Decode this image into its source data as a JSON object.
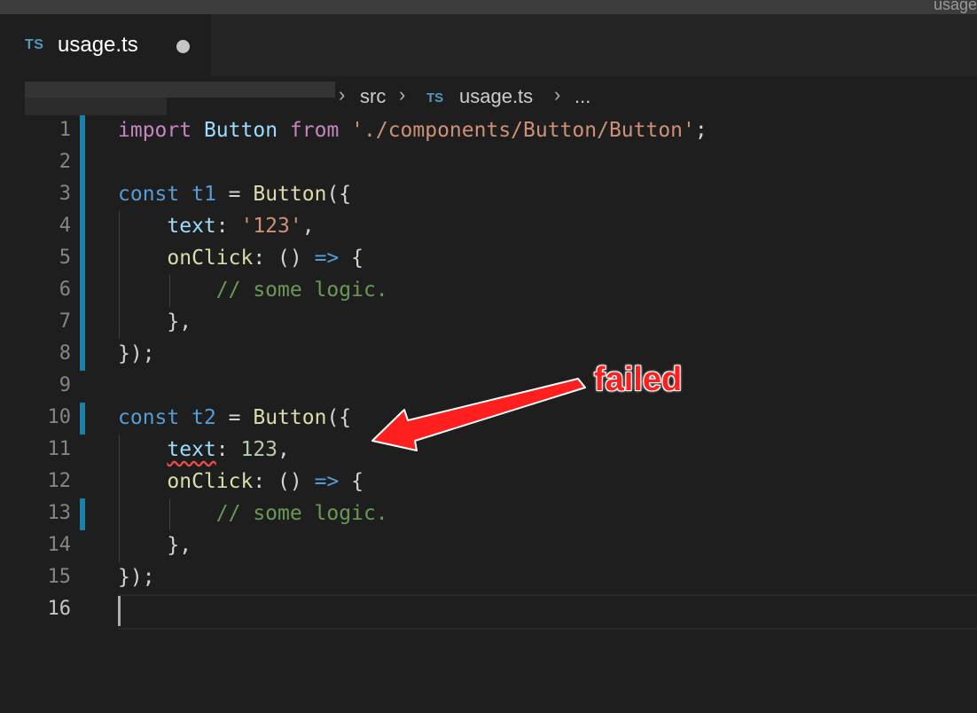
{
  "window": {
    "title_fragment": "usage"
  },
  "tab": {
    "icon": "TS",
    "filename": "usage.ts",
    "modified_dot": "●"
  },
  "breadcrumb": {
    "items": [
      {
        "label": "src"
      },
      {
        "icon": "TS",
        "label": "usage.ts"
      },
      {
        "label": "..."
      }
    ]
  },
  "editor": {
    "line_numbers": [
      "1",
      "2",
      "3",
      "4",
      "5",
      "6",
      "7",
      "8",
      "9",
      "10",
      "11",
      "12",
      "13",
      "14",
      "15",
      "16"
    ],
    "lines": {
      "l1": {
        "kw_import": "import",
        "ident": "Button",
        "kw_from": "from",
        "path": "'./components/Button/Button'",
        "semi": ";"
      },
      "l3": {
        "kw": "const",
        "name": "t1",
        "eq": " = ",
        "fn": "Button",
        "open": "({"
      },
      "l4": {
        "prop": "text",
        "colon": ": ",
        "value": "'123'",
        "comma": ","
      },
      "l5": {
        "prop": "onClick",
        "rest1": ": () ",
        "arrow": "=>",
        "rest2": " {"
      },
      "l6": {
        "comment": "// some logic."
      },
      "l7": {
        "text": "},"
      },
      "l8": {
        "text": "});"
      },
      "l10": {
        "kw": "const",
        "name": "t2",
        "eq": " = ",
        "fn": "Button",
        "open": "({"
      },
      "l11": {
        "prop": "text",
        "colon": ": ",
        "value": "123",
        "comma": ","
      },
      "l12": {
        "prop": "onClick",
        "rest1": ": () ",
        "arrow": "=>",
        "rest2": " {"
      },
      "l13": {
        "comment": "// some logic."
      },
      "l14": {
        "text": "},"
      },
      "l15": {
        "text": "});"
      }
    }
  },
  "annotation": {
    "label": "failed",
    "color": "#ff1f1f"
  },
  "colors": {
    "background": "#1e1e1e",
    "gutter_modified": "#1b81a8",
    "keyword": "#569cd6",
    "string": "#ce9178",
    "number": "#b5cea8",
    "comment": "#6a9955",
    "error_squiggle": "#f14c4c"
  }
}
